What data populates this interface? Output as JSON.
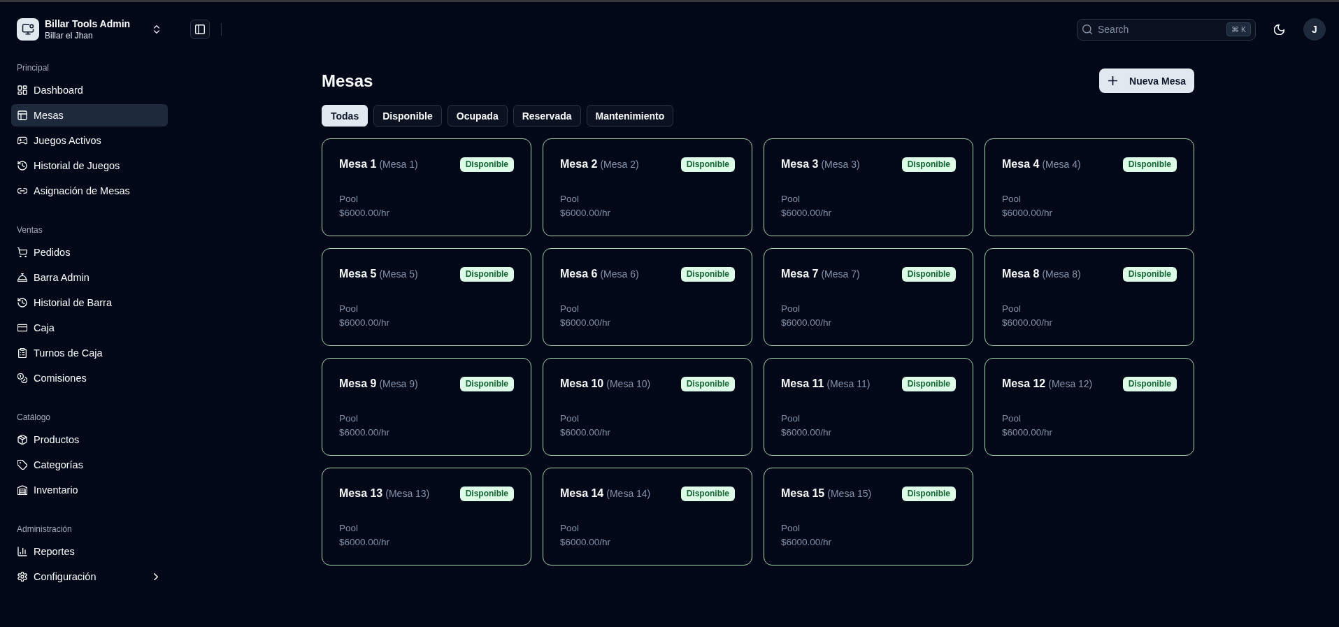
{
  "sidebar": {
    "app_name": "Billar Tools Admin",
    "workspace": "Billar el Jhan",
    "groups": [
      {
        "label": "Principal",
        "items": [
          {
            "label": "Dashboard",
            "kind": "link",
            "selected": false
          },
          {
            "label": "Mesas",
            "kind": "link",
            "selected": true
          },
          {
            "label": "Juegos Activos",
            "kind": "link",
            "selected": false
          },
          {
            "label": "Historial de Juegos",
            "kind": "link",
            "selected": false
          },
          {
            "label": "Asignación de Mesas",
            "kind": "link",
            "selected": false
          }
        ]
      },
      {
        "label": "Ventas",
        "items": [
          {
            "label": "Pedidos",
            "kind": "link",
            "selected": false
          },
          {
            "label": "Barra Admin",
            "kind": "link",
            "selected": false
          },
          {
            "label": "Historial de Barra",
            "kind": "link",
            "selected": false
          },
          {
            "label": "Caja",
            "kind": "link",
            "selected": false
          },
          {
            "label": "Turnos de Caja",
            "kind": "link",
            "selected": false
          },
          {
            "label": "Comisiones",
            "kind": "link",
            "selected": false
          }
        ]
      },
      {
        "label": "Catálogo",
        "items": [
          {
            "label": "Productos",
            "kind": "link",
            "selected": false
          },
          {
            "label": "Categorías",
            "kind": "link",
            "selected": false
          },
          {
            "label": "Inventario",
            "kind": "link",
            "selected": false
          }
        ]
      },
      {
        "label": "Administración",
        "items": [
          {
            "label": "Reportes",
            "kind": "link",
            "selected": false
          },
          {
            "label": "Configuración",
            "kind": "collapsible",
            "selected": false
          }
        ]
      }
    ]
  },
  "topbar": {
    "search": {
      "placeholder": "Search",
      "shortcut": "⌘ K"
    },
    "avatar": "J"
  },
  "page": {
    "title": "Mesas",
    "new_button": "Nueva Mesa",
    "filters": [
      {
        "label": "Todas",
        "selected": true
      },
      {
        "label": "Disponible",
        "selected": false
      },
      {
        "label": "Ocupada",
        "selected": false
      },
      {
        "label": "Reservada",
        "selected": false
      },
      {
        "label": "Mantenimiento",
        "selected": false
      }
    ],
    "tables": [
      {
        "name": "Mesa 1",
        "alias": "(Mesa 1)",
        "status": "Disponible",
        "type": "Pool",
        "rate": "$6000.00/hr"
      },
      {
        "name": "Mesa 2",
        "alias": "(Mesa 2)",
        "status": "Disponible",
        "type": "Pool",
        "rate": "$6000.00/hr"
      },
      {
        "name": "Mesa 3",
        "alias": "(Mesa 3)",
        "status": "Disponible",
        "type": "Pool",
        "rate": "$6000.00/hr"
      },
      {
        "name": "Mesa 4",
        "alias": "(Mesa 4)",
        "status": "Disponible",
        "type": "Pool",
        "rate": "$6000.00/hr"
      },
      {
        "name": "Mesa 5",
        "alias": "(Mesa 5)",
        "status": "Disponible",
        "type": "Pool",
        "rate": "$6000.00/hr"
      },
      {
        "name": "Mesa 6",
        "alias": "(Mesa 6)",
        "status": "Disponible",
        "type": "Pool",
        "rate": "$6000.00/hr"
      },
      {
        "name": "Mesa 7",
        "alias": "(Mesa 7)",
        "status": "Disponible",
        "type": "Pool",
        "rate": "$6000.00/hr"
      },
      {
        "name": "Mesa 8",
        "alias": "(Mesa 8)",
        "status": "Disponible",
        "type": "Pool",
        "rate": "$6000.00/hr"
      },
      {
        "name": "Mesa 9",
        "alias": "(Mesa 9)",
        "status": "Disponible",
        "type": "Pool",
        "rate": "$6000.00/hr"
      },
      {
        "name": "Mesa 10",
        "alias": "(Mesa 10)",
        "status": "Disponible",
        "type": "Pool",
        "rate": "$6000.00/hr"
      },
      {
        "name": "Mesa 11",
        "alias": "(Mesa 11)",
        "status": "Disponible",
        "type": "Pool",
        "rate": "$6000.00/hr"
      },
      {
        "name": "Mesa 12",
        "alias": "(Mesa 12)",
        "status": "Disponible",
        "type": "Pool",
        "rate": "$6000.00/hr"
      },
      {
        "name": "Mesa 13",
        "alias": "(Mesa 13)",
        "status": "Disponible",
        "type": "Pool",
        "rate": "$6000.00/hr"
      },
      {
        "name": "Mesa 14",
        "alias": "(Mesa 14)",
        "status": "Disponible",
        "type": "Pool",
        "rate": "$6000.00/hr"
      },
      {
        "name": "Mesa 15",
        "alias": "(Mesa 15)",
        "status": "Disponible",
        "type": "Pool",
        "rate": "$6000.00/hr"
      }
    ]
  }
}
